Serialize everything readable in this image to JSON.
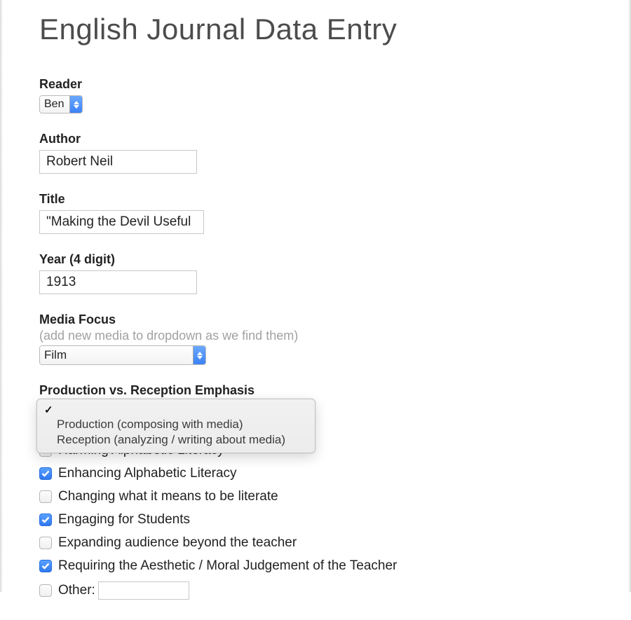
{
  "page": {
    "title": "English Journal Data Entry"
  },
  "reader": {
    "label": "Reader",
    "selected": "Ben"
  },
  "author": {
    "label": "Author",
    "value": "Robert Neil"
  },
  "title_field": {
    "label": "Title",
    "value": "\"Making the Devil Useful"
  },
  "year": {
    "label": "Year (4 digit)",
    "value": "1913"
  },
  "media_focus": {
    "label": "Media Focus",
    "hint": "(add new media to dropdown as we find them)",
    "selected": "Film"
  },
  "pvre": {
    "label": "Production vs. Reception Emphasis",
    "options": [
      {
        "text": "",
        "selected": true
      },
      {
        "text": "Production (composing with media)",
        "selected": false
      },
      {
        "text": "Reception (analyzing / writing about media)",
        "selected": false
      }
    ]
  },
  "checkboxes": [
    {
      "label": "Harming Alphabetic Literacy",
      "checked": false
    },
    {
      "label": "Enhancing Alphabetic Literacy",
      "checked": true
    },
    {
      "label": "Changing what it means to be literate",
      "checked": false
    },
    {
      "label": "Engaging for Students",
      "checked": true
    },
    {
      "label": "Expanding audience beyond the teacher",
      "checked": false
    },
    {
      "label": "Requiring the Aesthetic / Moral Judgement of the Teacher",
      "checked": true
    }
  ],
  "other": {
    "label": "Other:",
    "checked": false,
    "value": ""
  }
}
